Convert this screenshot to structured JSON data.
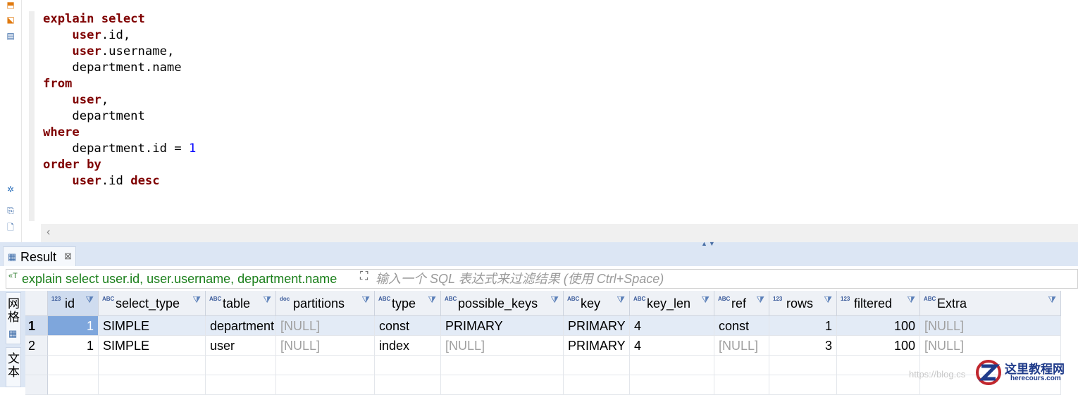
{
  "editor": {
    "lines": [
      [
        {
          "t": "explain select",
          "c": "kw"
        }
      ],
      [
        {
          "t": "    "
        },
        {
          "t": "user",
          "c": "kw"
        },
        {
          "t": ".id,"
        }
      ],
      [
        {
          "t": "    "
        },
        {
          "t": "user",
          "c": "kw"
        },
        {
          "t": ".username,"
        }
      ],
      [
        {
          "t": "    department.name"
        }
      ],
      [
        {
          "t": "from",
          "c": "kw"
        }
      ],
      [
        {
          "t": "    "
        },
        {
          "t": "user",
          "c": "kw"
        },
        {
          "t": ","
        }
      ],
      [
        {
          "t": "    department"
        }
      ],
      [
        {
          "t": "where",
          "c": "kw"
        }
      ],
      [
        {
          "t": "    department.id = "
        },
        {
          "t": "1",
          "c": "num"
        }
      ],
      [
        {
          "t": "order by",
          "c": "kw"
        }
      ],
      [
        {
          "t": "    "
        },
        {
          "t": "user",
          "c": "kw"
        },
        {
          "t": ".id "
        },
        {
          "t": "desc",
          "c": "kw"
        }
      ]
    ]
  },
  "result_tab": {
    "label": "Result",
    "close": "⊠"
  },
  "filter": {
    "query": "explain select user.id, user.username, department.name",
    "placeholder": "输入一个 SQL 表达式来过滤结果 (使用 Ctrl+Space)"
  },
  "side_tabs": {
    "grid": "网格",
    "text": "文本"
  },
  "columns": [
    {
      "name": "id",
      "type": "123"
    },
    {
      "name": "select_type",
      "type": "ABC"
    },
    {
      "name": "table",
      "type": "ABC"
    },
    {
      "name": "partitions",
      "type": "doc"
    },
    {
      "name": "type",
      "type": "ABC"
    },
    {
      "name": "possible_keys",
      "type": "ABC"
    },
    {
      "name": "key",
      "type": "ABC"
    },
    {
      "name": "key_len",
      "type": "ABC"
    },
    {
      "name": "ref",
      "type": "ABC"
    },
    {
      "name": "rows",
      "type": "123"
    },
    {
      "name": "filtered",
      "type": "123"
    },
    {
      "name": "Extra",
      "type": "ABC"
    }
  ],
  "rows": [
    {
      "num": "1",
      "cells": [
        "1",
        "SIMPLE",
        "department",
        "[NULL]",
        "const",
        "PRIMARY",
        "PRIMARY",
        "4",
        "const",
        "1",
        "100",
        "[NULL]"
      ]
    },
    {
      "num": "2",
      "cells": [
        "1",
        "SIMPLE",
        "user",
        "[NULL]",
        "index",
        "[NULL]",
        "PRIMARY",
        "4",
        "[NULL]",
        "3",
        "100",
        "[NULL]"
      ]
    }
  ],
  "watermark": {
    "url": "https://blog.cs",
    "brand": "这里教程网",
    "site": "herecours.com"
  },
  "colors": {
    "keyword": "#7f0000",
    "number": "#0000ff",
    "filter_query": "#1a7f1a",
    "selection": "#7ea6dc"
  }
}
